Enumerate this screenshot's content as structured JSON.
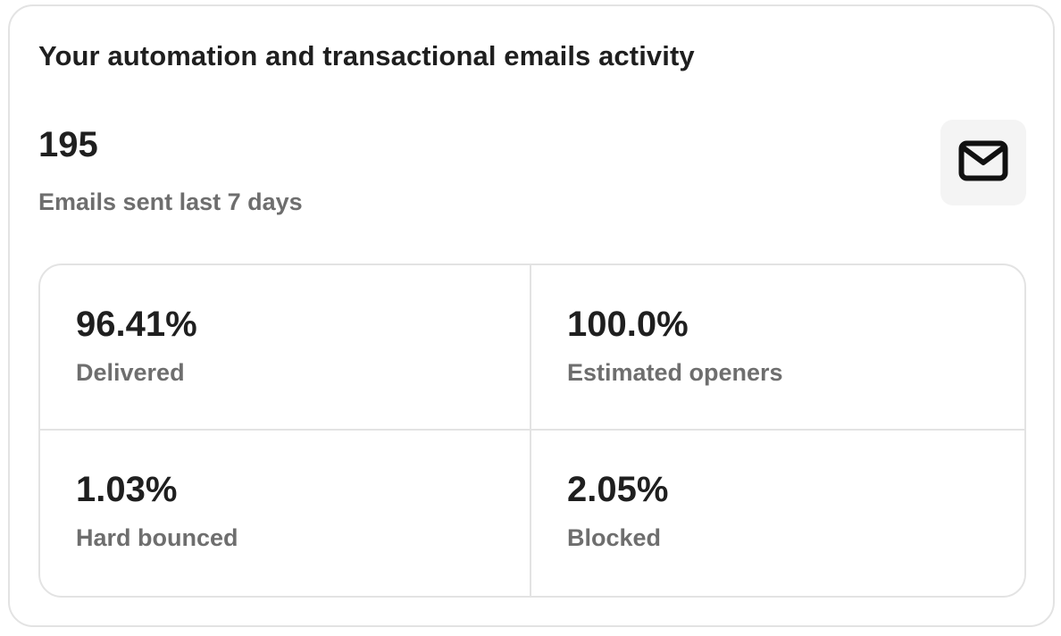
{
  "card": {
    "title": "Your automation and transactional emails activity",
    "total": {
      "value": "195",
      "label": "Emails sent last 7 days",
      "icon": "mail-icon"
    },
    "stats": [
      {
        "value": "96.41%",
        "label": "Delivered"
      },
      {
        "value": "100.0%",
        "label": "Estimated openers"
      },
      {
        "value": "1.03%",
        "label": "Hard bounced"
      },
      {
        "value": "2.05%",
        "label": "Blocked"
      }
    ]
  }
}
